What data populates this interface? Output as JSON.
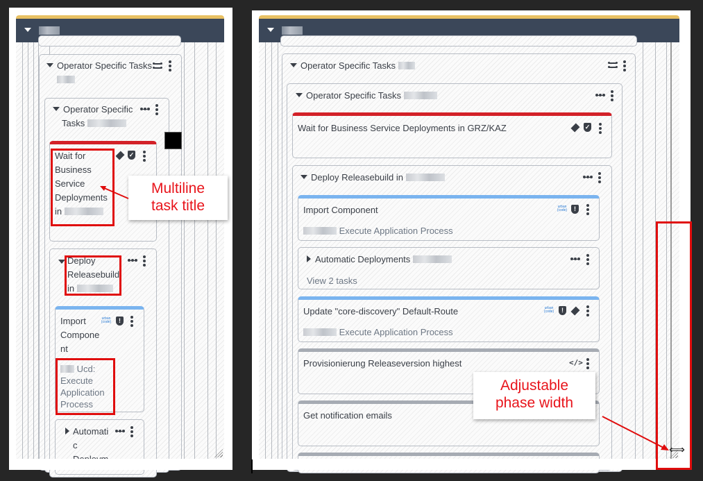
{
  "left_panel": {
    "phase": {
      "name_redacted": true
    },
    "group_outer": {
      "title": "Operator Specific Tasks",
      "icon": "parallel-icon"
    },
    "group_inner": {
      "title_line1": "Operator Specific",
      "title_line2": "Tasks",
      "icon": "sequential-icon"
    },
    "task_wait": {
      "lines": [
        "Wait for",
        "Business",
        "Service",
        "Deployments",
        "in"
      ],
      "color": "#d32128"
    },
    "group_deploy": {
      "lines": [
        "Deploy",
        "Releasebuild",
        "in"
      ]
    },
    "task_import": {
      "lines": [
        "Import",
        "Compone",
        "nt"
      ],
      "sub_lines": [
        "Ucd:",
        "Execute",
        "Application",
        "Process"
      ],
      "color": "#7ab4ef"
    },
    "group_auto": {
      "lines": [
        "Automati",
        "c",
        "Deploym"
      ]
    }
  },
  "right_panel": {
    "group_outer": {
      "title": "Operator Specific Tasks"
    },
    "group_inner": {
      "title": "Operator Specific Tasks"
    },
    "task_wait": {
      "title": "Wait for Business Service Deployments in GRZ/KAZ",
      "color": "#d32128"
    },
    "group_deploy": {
      "title": "Deploy Releasebuild in"
    },
    "task_import": {
      "title": "Import Component",
      "subtitle": "Execute Application Process",
      "color": "#7ab4ef"
    },
    "group_auto": {
      "title": "Automatic Deployments",
      "view_link": "View 2 tasks"
    },
    "task_update": {
      "title": "Update \"core-discovery\" Default-Route",
      "subtitle": "Execute Application Process",
      "color": "#7ab4ef"
    },
    "task_prov": {
      "title": "Provisionierung Releaseversion highest",
      "color": "#a6abb3"
    },
    "task_notify": {
      "title": "Get notification emails",
      "color": "#a6abb3"
    }
  },
  "annotations": {
    "multiline": [
      "Multiline",
      "task title"
    ],
    "adjustable": [
      "Adjustable",
      "phase width"
    ]
  },
  "icons": {
    "urban_code_top": "urban",
    "urban_code_bottom": "{code}",
    "code_glyph": "</>",
    "resize_cursor": "⟺"
  }
}
